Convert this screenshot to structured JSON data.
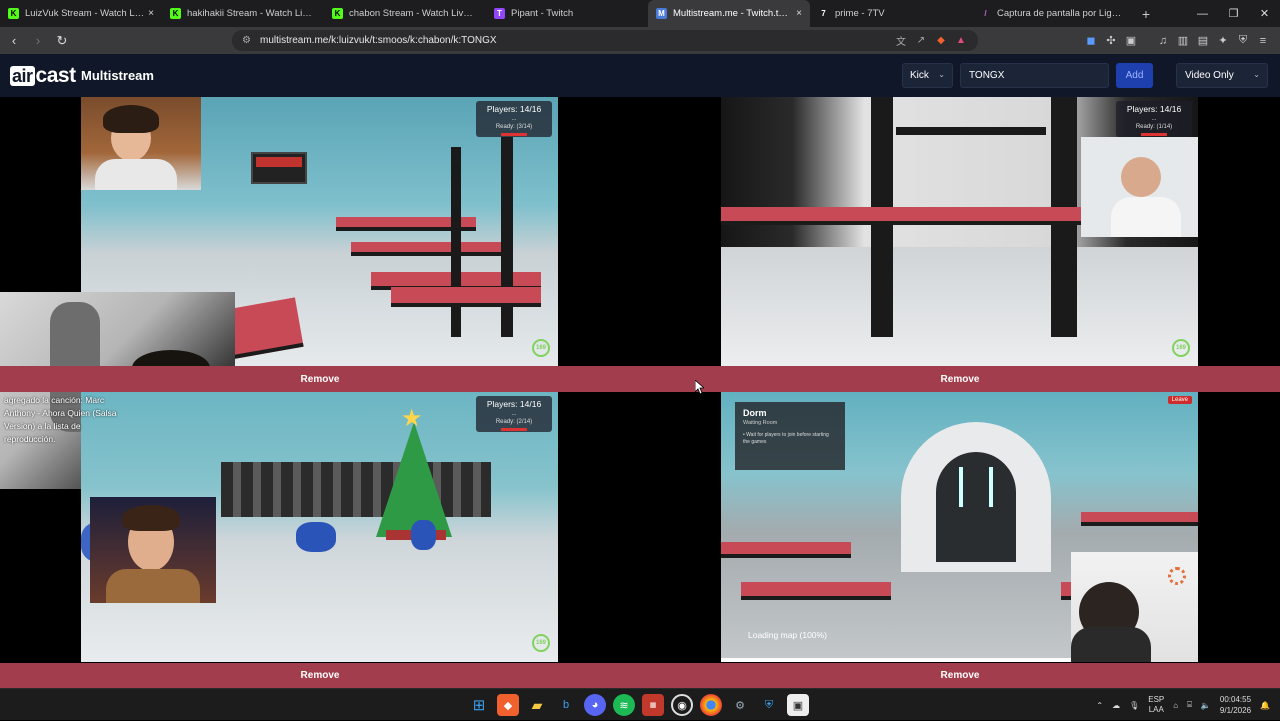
{
  "browser": {
    "tabs": [
      {
        "label": "LuizVuk Stream - Watch Live on",
        "favicon": "K",
        "color": "#53fc18",
        "active": false
      },
      {
        "label": "hakihakii Stream - Watch Live on",
        "favicon": "K",
        "color": "#53fc18",
        "active": false
      },
      {
        "label": "chabon Stream - Watch Live on",
        "favicon": "K",
        "color": "#53fc18",
        "active": false
      },
      {
        "label": "Pipant - Twitch",
        "favicon": "T",
        "color": "#9146ff",
        "active": false
      },
      {
        "label": "Multistream.me - Twitch.tv / K",
        "favicon": "M",
        "color": "#4a7bd8",
        "active": true
      },
      {
        "label": "prime - 7TV",
        "favicon": "7",
        "color": "#ffffff",
        "active": false
      },
      {
        "label": "Captura de pantalla por Lightshot",
        "favicon": "/",
        "color": "#c06adf",
        "active": false
      }
    ],
    "url": "multistream.me/k:luizvuk/t:smoos/k:chabon/k:TONGX"
  },
  "app": {
    "logo": {
      "part1": "air",
      "part2": "cast"
    },
    "title": "Multistream",
    "platform_select": "Kick",
    "channel_input": "TONGX",
    "add_label": "Add",
    "mode_select": "Video Only"
  },
  "streams": [
    {
      "hud_title": "Players: 14/16",
      "hud_dots": "...",
      "hud_ready": "Ready: (3/14)",
      "ping": "169",
      "remove_label": "Remove"
    },
    {
      "hud_title": "Players: 14/16",
      "hud_dots": "...",
      "hud_ready": "Ready: (1/14)",
      "ping": "169",
      "remove_label": "Remove"
    },
    {
      "hud_title": "Players: 14/16",
      "hud_dots": "...",
      "hud_ready": "Ready: (2/14)",
      "ping": "169",
      "remove_label": "Remove"
    },
    {
      "dorm_title": "Dorm",
      "dorm_sub": "Waiting Room",
      "dorm_desc": "• Wait for players to join before starting the games",
      "leave_label": "Leave",
      "loading_text": "Loading map (100%)",
      "remove_label": "Remove"
    }
  ],
  "chat_overlay": "agregado la canción: Marc Anthony - Ahora Quien (Salsa Version) a la lista de reproducción.",
  "taskbar": {
    "apps": [
      "windows-start",
      "brave",
      "files",
      "bing",
      "discord",
      "spotify",
      "dashboard",
      "obs",
      "chrome",
      "steam",
      "shield",
      "capture"
    ],
    "lang_top": "ESP",
    "lang_bottom": "LAA",
    "time": "00:04:55",
    "date": "9/1/2026"
  }
}
